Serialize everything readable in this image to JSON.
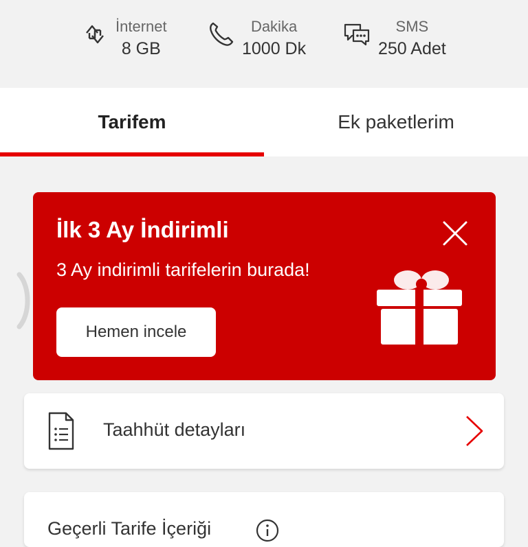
{
  "usage": [
    {
      "icon": "data-transfer-icon",
      "label": "İnternet",
      "value": "8 GB"
    },
    {
      "icon": "phone-icon",
      "label": "Dakika",
      "value": "1000 Dk"
    },
    {
      "icon": "chat-bubbles-icon",
      "label": "SMS",
      "value": "250 Adet"
    }
  ],
  "tabs": [
    {
      "label": "Tarifem",
      "active": true
    },
    {
      "label": "Ek paketlerim",
      "active": false
    }
  ],
  "promo": {
    "title": "İlk 3 Ay İndirimli",
    "subtitle": "3 Ay indirimli tarifelerin burada!",
    "cta_label": "Hemen incele",
    "background": "#cc0000"
  },
  "commitment": {
    "label": "Taahhüt detayları",
    "icon": "document-icon"
  },
  "tariff_content": {
    "label": "Geçerli Tarife İçeriği",
    "icon": "info-icon"
  },
  "colors": {
    "accent": "#e60000",
    "promo": "#cc0000"
  }
}
